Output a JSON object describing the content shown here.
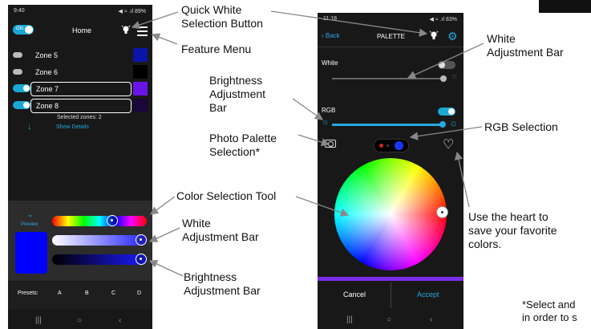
{
  "phone1": {
    "status_time": "9:40",
    "status_right": "◀ ≈ .ıl 89%",
    "power_label": "ON",
    "title": "Home",
    "zones": [
      {
        "label": "Zone 5",
        "color": "#0b14a8",
        "active": false,
        "selected": false
      },
      {
        "label": "Zone 6",
        "color": "#000000",
        "active": false,
        "selected": false
      },
      {
        "label": "Zone 7",
        "color": "#6a13e8",
        "active": true,
        "selected": true
      },
      {
        "label": "Zone 8",
        "color": "#1a0638",
        "active": true,
        "selected": true
      }
    ],
    "selected_zones": "Selected zones: 2",
    "show_details": "Show Details",
    "preview_label": "Preview",
    "preview_color": "#0000ff",
    "presets_label": "Presets:",
    "presets": [
      "A",
      "B",
      "C",
      "D"
    ]
  },
  "phone2": {
    "status_time": "11:18",
    "status_right": "◀ ≈ .ıl 83%",
    "back_label": "Back",
    "title": "PALETTE",
    "white_label": "White",
    "rgb_label": "RGB",
    "cancel_label": "Cancel",
    "accept_label": "Accept",
    "accent": "#7a2de8"
  },
  "annotations": {
    "quick_white_1": "Quick White",
    "quick_white_2": "Selection Button",
    "feature_menu": "Feature Menu",
    "white_adj_r1": "White",
    "white_adj_r2": "Adjustment Bar",
    "brightness_1": "Brightness",
    "brightness_2": "Adjustment",
    "brightness_3": "Bar",
    "rgb_selection": "RGB Selection",
    "photo_1": "Photo Palette",
    "photo_2": "Selection*",
    "color_tool": "Color Selection Tool",
    "white_adj_l1": "White",
    "white_adj_l2": "Adjustment Bar",
    "bright_l1": "Brightness",
    "bright_l2": "Adjustment Bar",
    "heart_1": "Use the heart to",
    "heart_2": "save your favorite",
    "heart_3": "colors.",
    "footnote_1": "*Select and",
    "footnote_2": "in order to s"
  }
}
